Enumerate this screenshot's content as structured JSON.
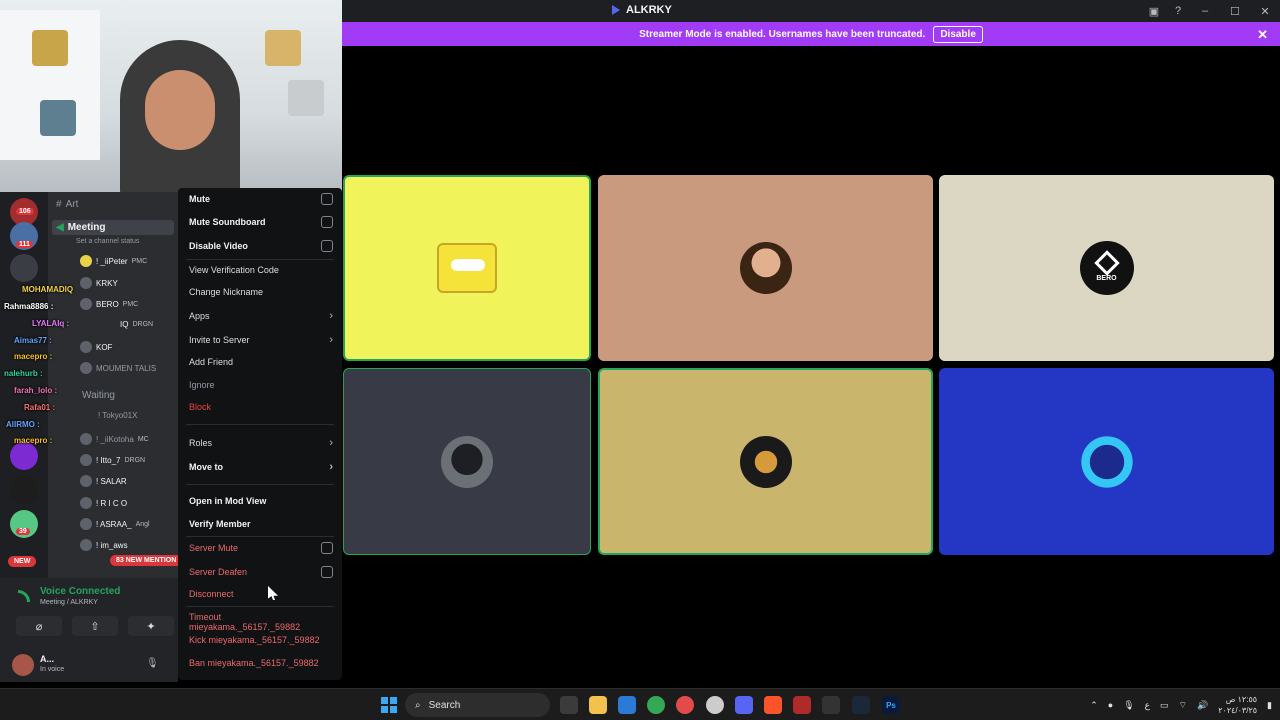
{
  "window": {
    "title": "ALKRKY"
  },
  "banner": {
    "text": "Streamer Mode is enabled. Usernames have been truncated.",
    "button": "Disable"
  },
  "tiles": [
    {
      "name": "spongebob",
      "bg": "#f1f35b"
    },
    {
      "name": "user-photo",
      "bg": "#c99a7e"
    },
    {
      "name": "bero",
      "bg": "#dcd7c2",
      "logo_text": "BERO"
    },
    {
      "name": "dark-avatar",
      "bg": "#383b45"
    },
    {
      "name": "minecraft-avatar",
      "bg": "#c9b56b"
    },
    {
      "name": "anime-avatar",
      "bg": "#2436c4"
    }
  ],
  "server_rail": {
    "badges": [
      "106",
      "111",
      "39"
    ],
    "new_label": "NEW"
  },
  "channels": {
    "art": "Art",
    "meeting": "Meeting",
    "meeting_status": "Set a channel status",
    "waiting": "Waiting",
    "mentions": "83 NEW MENTION"
  },
  "members": [
    {
      "name": "! _iiPeter",
      "tag": "PMC"
    },
    {
      "name": "KRKY",
      "tag": ""
    },
    {
      "name": "BERO",
      "tag": "PMC"
    },
    {
      "name": "IQ",
      "tag": "DRGN"
    },
    {
      "name": "KOF",
      "tag": ""
    },
    {
      "name": "MOUMEN TALIS",
      "tag": ""
    },
    {
      "name": "! Tokyo01X",
      "tag": ""
    },
    {
      "name": "! _iiKotoha",
      "tag": "MC"
    },
    {
      "name": "! Itto_7",
      "tag": "DRGN"
    },
    {
      "name": "! SALAR",
      "tag": ""
    },
    {
      "name": "! R I C O",
      "tag": ""
    },
    {
      "name": "! ASRAA_",
      "tag": "Angl"
    },
    {
      "name": "! im_aws",
      "tag": ""
    }
  ],
  "chat": [
    {
      "text": "MOHAMADIQ",
      "color": "#f5d442"
    },
    {
      "text": "Rahma8886 :",
      "color": "#ffffff"
    },
    {
      "text": "LYALAIq :",
      "color": "#e879f9"
    },
    {
      "text": "Aimas77 :",
      "color": "#60a5fa"
    },
    {
      "text": "macepro :",
      "color": "#fbbf24"
    },
    {
      "text": "nalehurb :",
      "color": "#34d399"
    },
    {
      "text": "farah_lolo :",
      "color": "#f472b6"
    },
    {
      "text": "Rafa01 :",
      "color": "#f87171"
    },
    {
      "text": "AlIRMO :",
      "color": "#60a5fa"
    },
    {
      "text": "macepro :",
      "color": "#fbbf24"
    }
  ],
  "voice": {
    "title": "Voice Connected",
    "subtitle": "Meeting / ALKRKY",
    "user_name": "A...",
    "user_status": "In voice"
  },
  "context_menu": {
    "items": [
      {
        "label": "Mute",
        "kind": "checkbox",
        "style": "bold"
      },
      {
        "label": "Mute Soundboard",
        "kind": "checkbox",
        "style": "bold"
      },
      {
        "label": "Disable Video",
        "kind": "checkbox",
        "style": "bold"
      },
      {
        "label": "View Verification Code",
        "kind": "plain",
        "style": "normal"
      },
      {
        "label": "Change Nickname",
        "kind": "plain",
        "style": "normal"
      },
      {
        "label": "Apps",
        "kind": "submenu",
        "style": "normal"
      },
      {
        "label": "Invite to Server",
        "kind": "submenu",
        "style": "normal"
      },
      {
        "label": "Add Friend",
        "kind": "plain",
        "style": "normal"
      },
      {
        "label": "Ignore",
        "kind": "plain",
        "style": "muted"
      },
      {
        "label": "Block",
        "kind": "plain",
        "style": "danger"
      },
      {
        "label": "Roles",
        "kind": "submenu",
        "style": "normal"
      },
      {
        "label": "Move to",
        "kind": "submenu",
        "style": "bold"
      },
      {
        "label": "Open in Mod View",
        "kind": "plain",
        "style": "bold"
      },
      {
        "label": "Verify Member",
        "kind": "plain",
        "style": "bold"
      },
      {
        "label": "Server Mute",
        "kind": "checkbox",
        "style": "danger-soft"
      },
      {
        "label": "Server Deafen",
        "kind": "checkbox",
        "style": "danger-soft"
      },
      {
        "label": "Disconnect",
        "kind": "plain",
        "style": "danger-soft"
      },
      {
        "label": "Timeout mieyakama._56157._59882",
        "kind": "plain",
        "style": "danger-soft"
      },
      {
        "label": "Kick mieyakama._56157._59882",
        "kind": "plain",
        "style": "danger-soft"
      },
      {
        "label": "Ban mieyakama._56157._59882",
        "kind": "plain",
        "style": "danger-soft"
      }
    ]
  },
  "taskbar": {
    "search": "Search",
    "lang": "ع",
    "time": "١٢:٥٥ ص",
    "date": "٢٠٢٤/٠٣/٢٥"
  }
}
